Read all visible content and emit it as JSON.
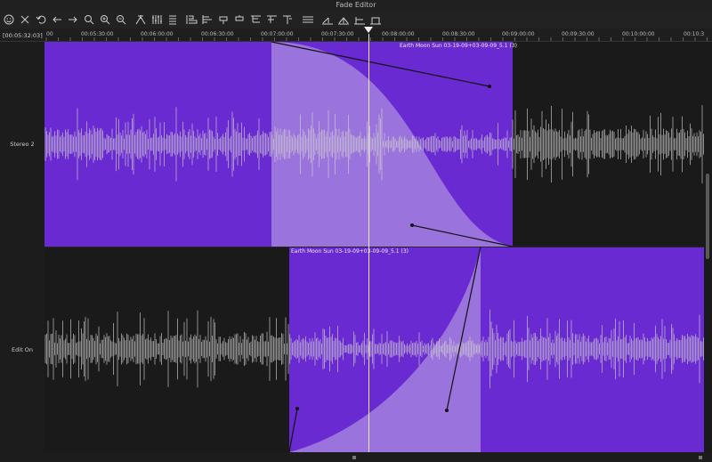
{
  "window": {
    "title": "Fade Editor"
  },
  "toolbar": {
    "icons": [
      "smiley-icon",
      "close-icon",
      "undo-icon",
      "arrow-left-icon",
      "arrow-right-icon",
      "search-icon",
      "zoom-in-icon",
      "zoom-out-icon",
      "split-icon",
      "mixer-icon",
      "list-icon",
      "align-icon",
      "align-left-icon",
      "align-right-icon",
      "align-top-icon",
      "align-bottom-icon",
      "align-start-icon",
      "align-end-icon",
      "fade-in-icon",
      "fade-out-icon",
      "crossfade-icon",
      "fade-curve-icon",
      "fade-join-icon"
    ]
  },
  "ruler": {
    "timecode": "[00:05:32:03]",
    "labels": [
      "00",
      "00:05:30:00",
      "00:06:00:00",
      "00:06:30:00",
      "00:07:00:00",
      "00:07:30:00",
      "00:08:00:00",
      "00:08:30:00",
      "00:09:00:00",
      "00:09:30:00",
      "00:10:00:00",
      "00:10:3"
    ]
  },
  "tracks": [
    {
      "name": "Stereo 2",
      "clip_title": "Earth Moon Sun 03-19-09+03-09-09_5.1 (3)"
    },
    {
      "name": "Edit On",
      "clip_title": "Earth Moon Sun 03-19-09+03-09-09_5.1 (3)"
    }
  ],
  "colors": {
    "clip": "#6a2ad1",
    "fade_region": "#9b73dd",
    "fade_fill": "#6a2ad1",
    "waveform": "#cfcfcf",
    "playhead": "#f0f0f0"
  }
}
